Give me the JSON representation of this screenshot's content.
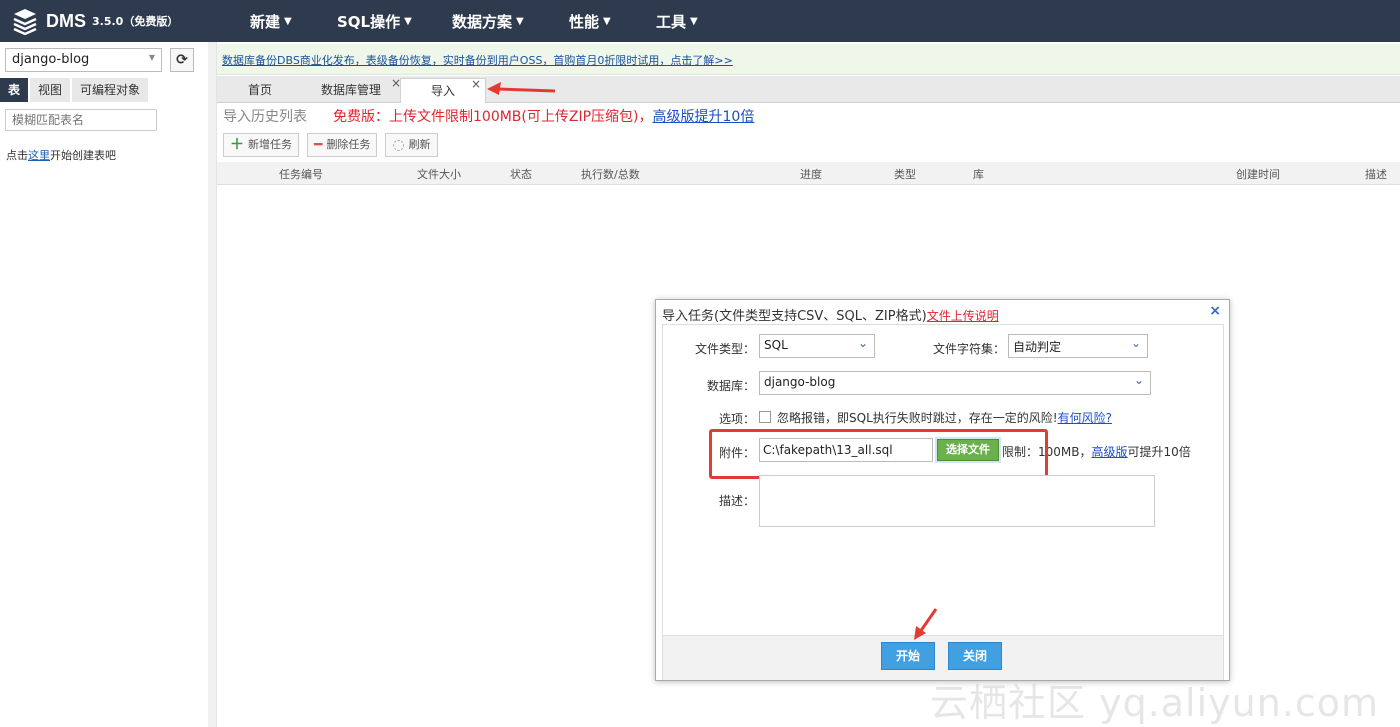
{
  "app": {
    "name": "DMS",
    "version": "3.5.0（免费版）"
  },
  "nav": [
    {
      "label": "新建"
    },
    {
      "label": "SQL操作"
    },
    {
      "label": "数据方案"
    },
    {
      "label": "性能"
    },
    {
      "label": "工具"
    }
  ],
  "sidebar": {
    "db_value": "django-blog",
    "tabs": [
      "表",
      "视图",
      "可编程对象"
    ],
    "search_placeholder": "模糊匹配表名",
    "hint_prefix": "点击",
    "hint_link": "这里",
    "hint_suffix": "开始创建表吧"
  },
  "banner": {
    "text": "数据库备份DBS商业化发布，表级备份恢复，实时备份到用户OSS，首购首月0折限时试用，点击了解>>"
  },
  "tabs": [
    {
      "label": "首页"
    },
    {
      "label": "数据库管理"
    },
    {
      "label": "导入"
    }
  ],
  "page": {
    "title": "导入历史列表",
    "notice": "免费版：上传文件限制100MB(可上传ZIP压缩包)，",
    "notice_link": "高级版提升10倍"
  },
  "toolbar": {
    "add": "新增任务",
    "delete": "删除任务",
    "refresh": "刷新"
  },
  "columns": [
    "任务编号",
    "文件大小",
    "状态",
    "执行数/总数",
    "进度",
    "类型",
    "库",
    "创建时间",
    "描述"
  ],
  "dialog": {
    "title": "导入任务(文件类型支持CSV、SQL、ZIP格式)",
    "title_link": "文件上传说明",
    "file_type_label": "文件类型：",
    "file_type_value": "SQL",
    "charset_label": "文件字符集：",
    "charset_value": "自动判定",
    "db_label": "数据库：",
    "db_value": "django-blog",
    "option_label": "选项：",
    "option_text": "忽略报错，即SQL执行失败时跳过，存在一定的风险!",
    "option_link": "有何风险?",
    "attach_label": "附件：",
    "attach_value": "C:\\fakepath\\13_all.sql",
    "choose_btn": "选择文件",
    "limit_prefix": "限制：100MB，",
    "limit_link": "高级版",
    "limit_suffix": "可提升10倍",
    "desc_label": "描述：",
    "start_btn": "开始",
    "close_btn": "关闭"
  },
  "watermark": "云栖社区 yq.aliyun.com",
  "colors": {
    "topbar": "#2e3a4d",
    "highlight": "#e23b34",
    "primary_button": "#41a0e2",
    "choose_button": "#6ab04c"
  }
}
